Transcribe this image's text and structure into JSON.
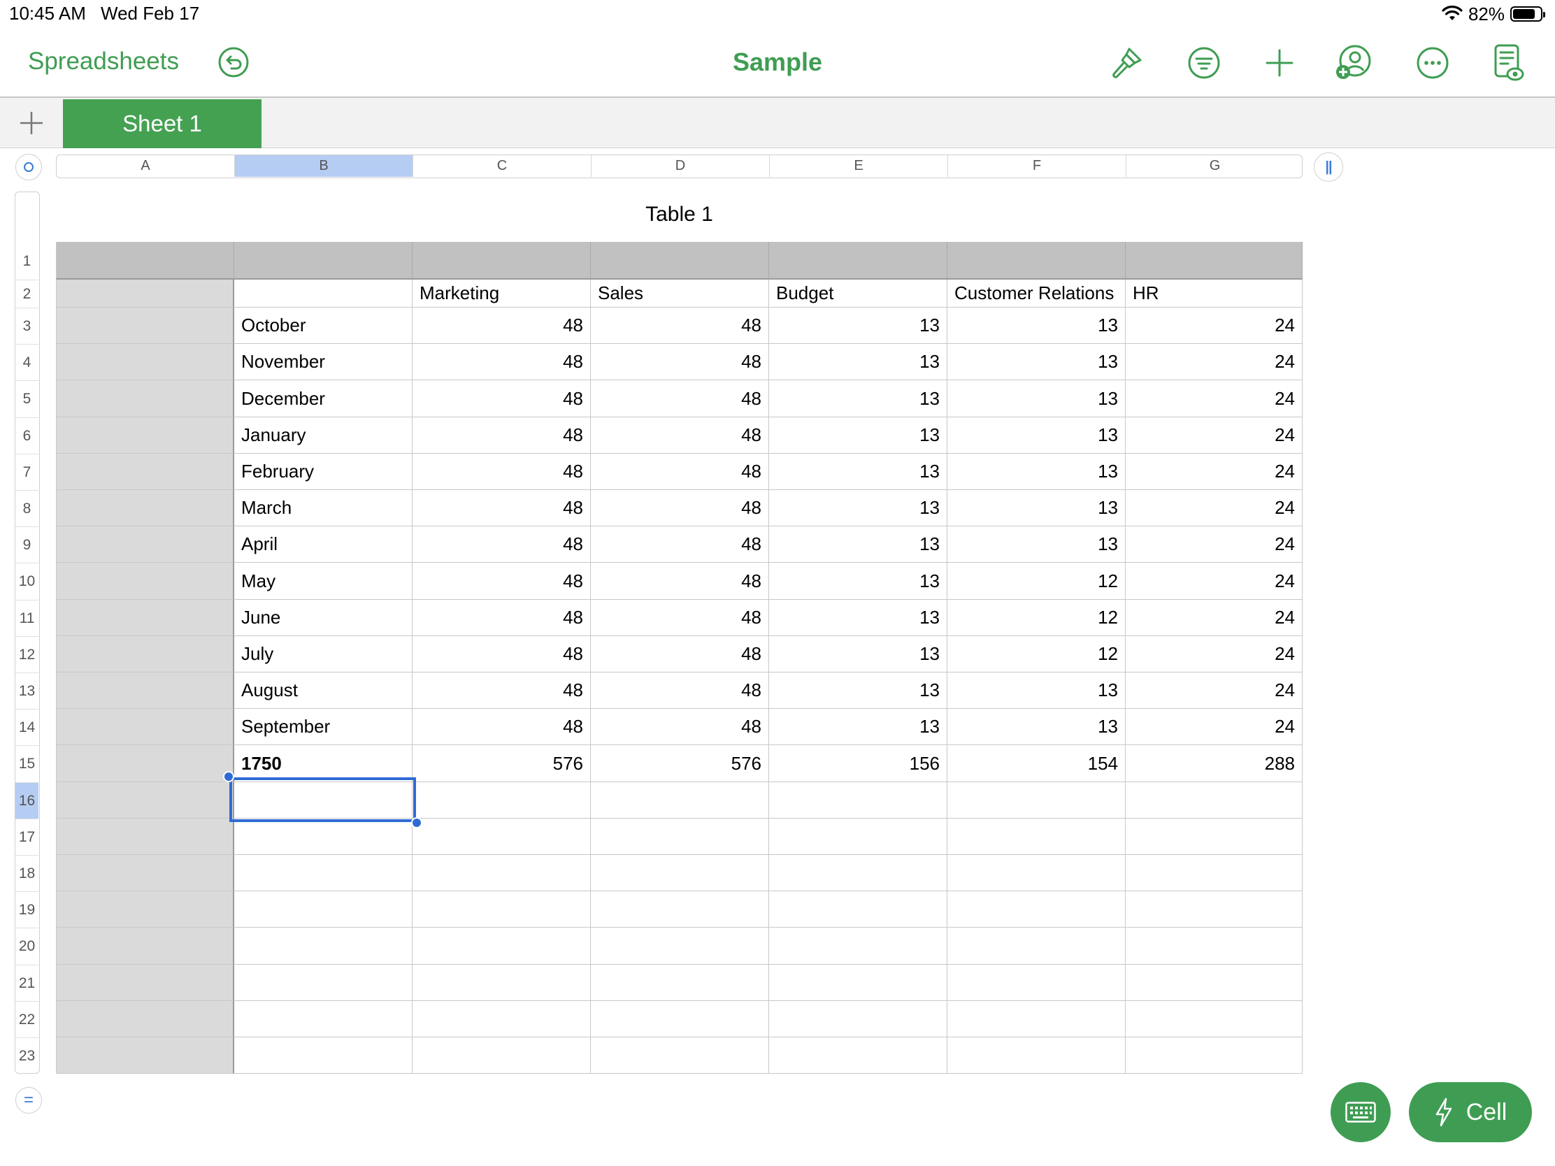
{
  "status_bar": {
    "time": "10:45 AM",
    "date": "Wed Feb 17",
    "battery": "82%",
    "battery_level": 0.82
  },
  "toolbar": {
    "back_label": "Spreadsheets",
    "title": "Sample",
    "accent_color": "#3f9d53",
    "icons": [
      "undo-icon",
      "paintbrush-icon",
      "filter-icon",
      "plus-icon",
      "collaborate-icon",
      "more-icon",
      "document-view-icon"
    ]
  },
  "sheets": {
    "tabs": [
      {
        "label": "Sheet 1",
        "active": true
      }
    ]
  },
  "columns": [
    "A",
    "B",
    "C",
    "D",
    "E",
    "F",
    "G"
  ],
  "selected_column": "B",
  "rows": [
    "1",
    "2",
    "3",
    "4",
    "5",
    "6",
    "7",
    "8",
    "9",
    "10",
    "11",
    "12",
    "13",
    "14",
    "15",
    "16",
    "17",
    "18",
    "19",
    "20",
    "21",
    "22",
    "23"
  ],
  "selected_row": "16",
  "table": {
    "title": "Table 1",
    "headers": [
      "",
      "",
      "Marketing",
      "Sales",
      "Budget",
      "Customer Relations",
      "HR"
    ],
    "data": [
      [
        "October",
        "48",
        "48",
        "13",
        "13",
        "24"
      ],
      [
        "November",
        "48",
        "48",
        "13",
        "13",
        "24"
      ],
      [
        "December",
        "48",
        "48",
        "13",
        "13",
        "24"
      ],
      [
        "January",
        "48",
        "48",
        "13",
        "13",
        "24"
      ],
      [
        "February",
        "48",
        "48",
        "13",
        "13",
        "24"
      ],
      [
        "March",
        "48",
        "48",
        "13",
        "13",
        "24"
      ],
      [
        "April",
        "48",
        "48",
        "13",
        "13",
        "24"
      ],
      [
        "May",
        "48",
        "48",
        "13",
        "12",
        "24"
      ],
      [
        "June",
        "48",
        "48",
        "13",
        "12",
        "24"
      ],
      [
        "July",
        "48",
        "48",
        "13",
        "12",
        "24"
      ],
      [
        "August",
        "48",
        "48",
        "13",
        "13",
        "24"
      ],
      [
        "September",
        "48",
        "48",
        "13",
        "13",
        "24"
      ],
      [
        "1750",
        "576",
        "576",
        "156",
        "154",
        "288"
      ]
    ]
  },
  "bottom": {
    "cell_button": "Cell"
  }
}
